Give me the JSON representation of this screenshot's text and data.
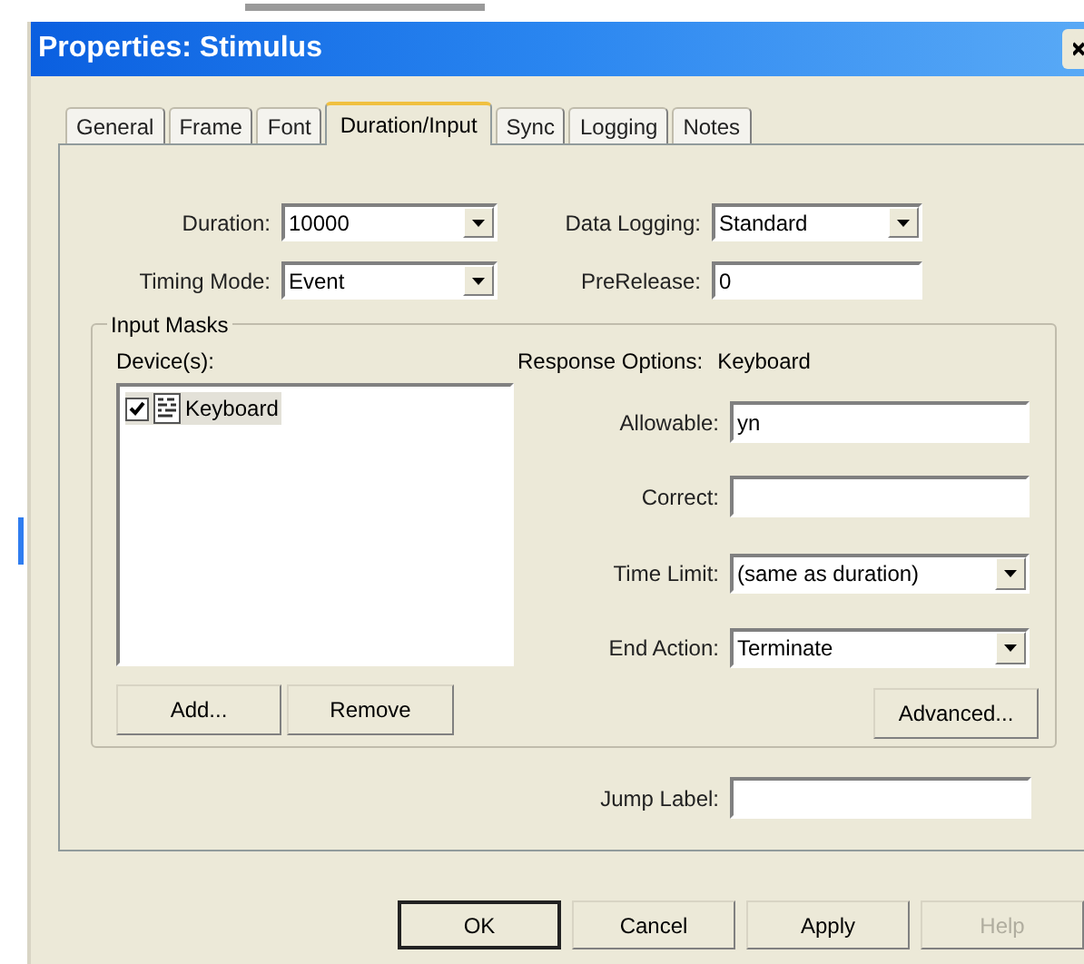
{
  "window": {
    "title": "Properties: Stimulus"
  },
  "tabs": [
    {
      "label": "General",
      "selected": false
    },
    {
      "label": "Frame",
      "selected": false
    },
    {
      "label": "Font",
      "selected": false
    },
    {
      "label": "Duration/Input",
      "selected": true
    },
    {
      "label": "Sync",
      "selected": false
    },
    {
      "label": "Logging",
      "selected": false
    },
    {
      "label": "Notes",
      "selected": false
    }
  ],
  "left_fields": [
    {
      "label": "Duration:",
      "value": "10000",
      "kind": "combo"
    },
    {
      "label": "Timing Mode:",
      "value": "Event",
      "kind": "combo"
    }
  ],
  "right_fields": [
    {
      "label": "Data Logging:",
      "value": "Standard",
      "kind": "combo"
    },
    {
      "label": "PreRelease:",
      "value": "0",
      "kind": "text"
    }
  ],
  "input_masks": {
    "title": "Input Masks",
    "devices_label": "Device(s):",
    "devices": [
      {
        "label": "Keyboard",
        "checked": true,
        "selected": true
      }
    ],
    "add_button": "Add...",
    "remove_button": "Remove",
    "response_label": "Response Options:",
    "response_device": "Keyboard",
    "response_fields": [
      {
        "label": "Allowable:",
        "value": "yn",
        "kind": "text"
      },
      {
        "label": "Correct:",
        "kind": "text"
      },
      {
        "label": "Time Limit:",
        "value": "(same as duration)",
        "kind": "combo"
      },
      {
        "label": "End Action:",
        "value": "Terminate",
        "kind": "combo"
      }
    ],
    "advanced_button": "Advanced..."
  },
  "jump_label": {
    "label": "Jump Label:"
  },
  "buttons": [
    {
      "label": "OK",
      "default": true,
      "disabled": false
    },
    {
      "label": "Cancel",
      "default": false,
      "disabled": false
    },
    {
      "label": "Apply",
      "default": false,
      "disabled": false
    },
    {
      "label": "Help",
      "default": false,
      "disabled": true
    }
  ]
}
